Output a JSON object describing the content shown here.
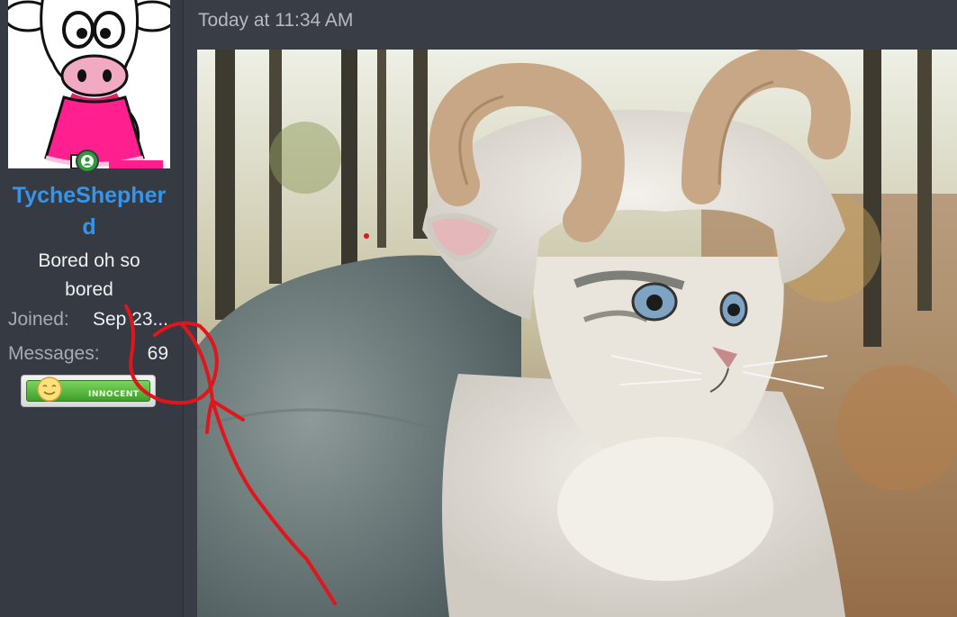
{
  "post": {
    "timestamp": "Today at 11:34 AM",
    "image_alt": "Cat wearing a fluffy sheep costume with horns"
  },
  "user": {
    "username": "TycheShepherd",
    "user_title": "Bored oh so bored",
    "avatar_icon": "cartoon-cow-avatar",
    "online_status_icon": "online-person-icon",
    "joined_label": "Joined:",
    "joined_value": "Sep 23...",
    "messages_label": "Messages:",
    "messages_value": "69",
    "badge_text": "INNOCENT",
    "badge_icon": "smiley-face-icon"
  },
  "colors": {
    "username": "#3794e8",
    "sidebar_bg": "#353a43",
    "main_bg": "#393d46",
    "online_green": "#2f9a3a",
    "annotation_red": "#e0161d"
  },
  "annotation": {
    "icon": "red-freehand-arrow"
  }
}
